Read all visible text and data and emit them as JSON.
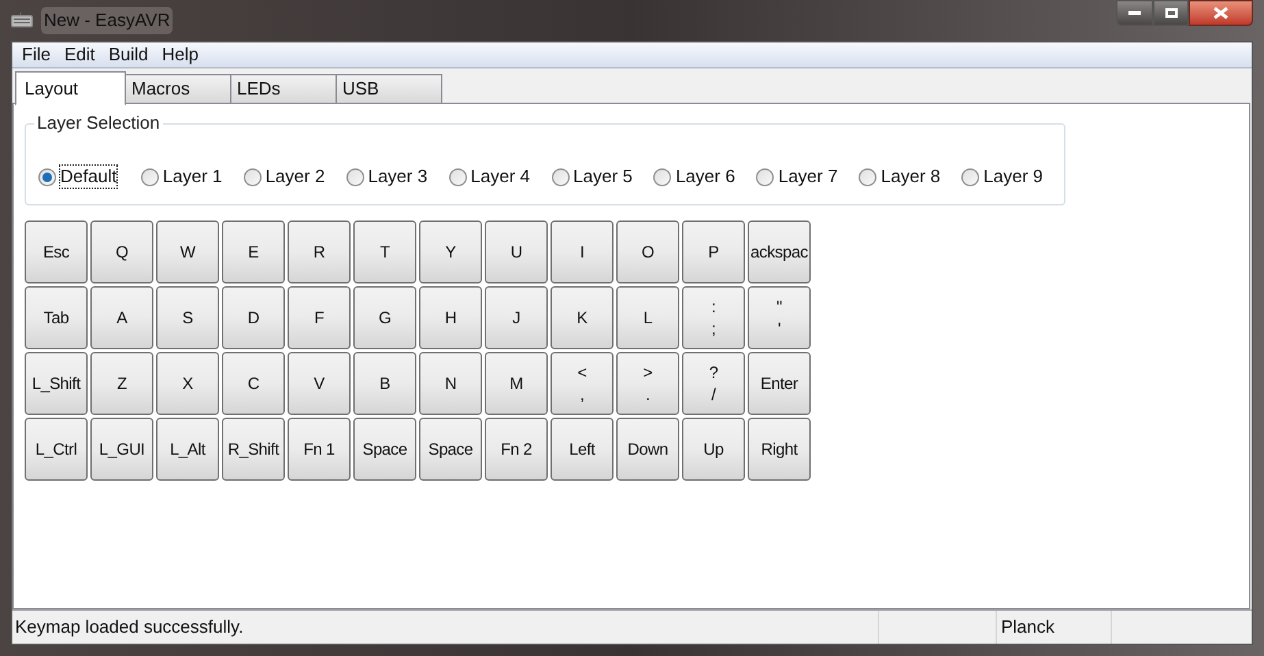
{
  "window": {
    "title": "New - EasyAVR"
  },
  "menu": [
    "File",
    "Edit",
    "Build",
    "Help"
  ],
  "tabs": [
    {
      "label": "Layout",
      "selected": true
    },
    {
      "label": "Macros",
      "selected": false
    },
    {
      "label": "LEDs",
      "selected": false
    },
    {
      "label": "USB",
      "selected": false
    }
  ],
  "layer_selection": {
    "title": "Layer Selection",
    "layers": [
      {
        "label": "Default",
        "selected": true
      },
      {
        "label": "Layer 1",
        "selected": false
      },
      {
        "label": "Layer 2",
        "selected": false
      },
      {
        "label": "Layer 3",
        "selected": false
      },
      {
        "label": "Layer 4",
        "selected": false
      },
      {
        "label": "Layer 5",
        "selected": false
      },
      {
        "label": "Layer 6",
        "selected": false
      },
      {
        "label": "Layer 7",
        "selected": false
      },
      {
        "label": "Layer 8",
        "selected": false
      },
      {
        "label": "Layer 9",
        "selected": false
      }
    ]
  },
  "keyboard": {
    "rows": [
      [
        [
          "Esc"
        ],
        [
          "Q"
        ],
        [
          "W"
        ],
        [
          "E"
        ],
        [
          "R"
        ],
        [
          "T"
        ],
        [
          "Y"
        ],
        [
          "U"
        ],
        [
          "I"
        ],
        [
          "O"
        ],
        [
          "P"
        ],
        [
          "ackspac"
        ]
      ],
      [
        [
          "Tab"
        ],
        [
          "A"
        ],
        [
          "S"
        ],
        [
          "D"
        ],
        [
          "F"
        ],
        [
          "G"
        ],
        [
          "H"
        ],
        [
          "J"
        ],
        [
          "K"
        ],
        [
          "L"
        ],
        [
          ":",
          ";"
        ],
        [
          "\"",
          "'"
        ]
      ],
      [
        [
          "L_Shift"
        ],
        [
          "Z"
        ],
        [
          "X"
        ],
        [
          "C"
        ],
        [
          "V"
        ],
        [
          "B"
        ],
        [
          "N"
        ],
        [
          "M"
        ],
        [
          "<",
          ","
        ],
        [
          ">",
          "."
        ],
        [
          "?",
          "/"
        ],
        [
          "Enter"
        ]
      ],
      [
        [
          "L_Ctrl"
        ],
        [
          "L_GUI"
        ],
        [
          "L_Alt"
        ],
        [
          "R_Shift"
        ],
        [
          "Fn 1"
        ],
        [
          "Space"
        ],
        [
          "Space"
        ],
        [
          "Fn 2"
        ],
        [
          "Left"
        ],
        [
          "Down"
        ],
        [
          "Up"
        ],
        [
          "Right"
        ]
      ]
    ]
  },
  "status_bar": {
    "message": "Keymap loaded successfully.",
    "keyboard": "Planck"
  }
}
